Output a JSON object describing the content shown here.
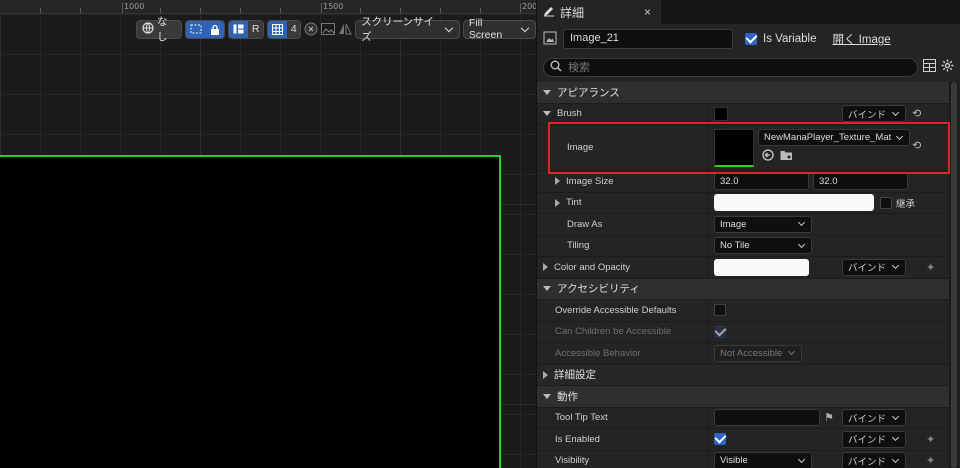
{
  "ruler": {
    "labels": [
      "1000",
      "1500",
      "200"
    ]
  },
  "viewport_toolbar": {
    "lang_label": "なし",
    "r_label": "R",
    "grid_count": "4",
    "screen_size_label": "スクリーンサイズ",
    "fill_screen_label": "Fill Screen"
  },
  "details": {
    "tab_title": "詳細",
    "tab_close": "×",
    "widget_name": "Image_21",
    "is_variable_label": "Is Variable",
    "is_variable_checked": true,
    "open_image_label": "開く Image",
    "search_placeholder": "検索"
  },
  "sections": {
    "appearance": "アピアランス",
    "accessibility": "アクセシビリティ",
    "advanced": "詳細設定",
    "behavior": "動作"
  },
  "props": {
    "brush_label": "Brush",
    "bind_label": "バインド",
    "image_label": "Image",
    "image_asset": "NewManaPlayer_Texture_Mat",
    "image_size_label": "Image Size",
    "image_size_x": "32.0",
    "image_size_y": "32.0",
    "tint_label": "Tint",
    "inherit_label": "継承",
    "draw_as_label": "Draw As",
    "draw_as_value": "Image",
    "tiling_label": "Tiling",
    "tiling_value": "No Tile",
    "color_opacity_label": "Color and Opacity",
    "override_label": "Override Accessible Defaults",
    "can_children_label": "Can Children be Accessible",
    "accessible_behavior_label": "Accessible Behavior",
    "accessible_behavior_value": "Not Accessible",
    "tooltip_label": "Tool Tip Text",
    "is_enabled_label": "Is Enabled",
    "visibility_label": "Visibility",
    "visibility_value": "Visible"
  },
  "colors": {
    "canvas_border": "#2ad12a",
    "highlight": "#e5202a",
    "accent_blue": "#2c64c8"
  }
}
